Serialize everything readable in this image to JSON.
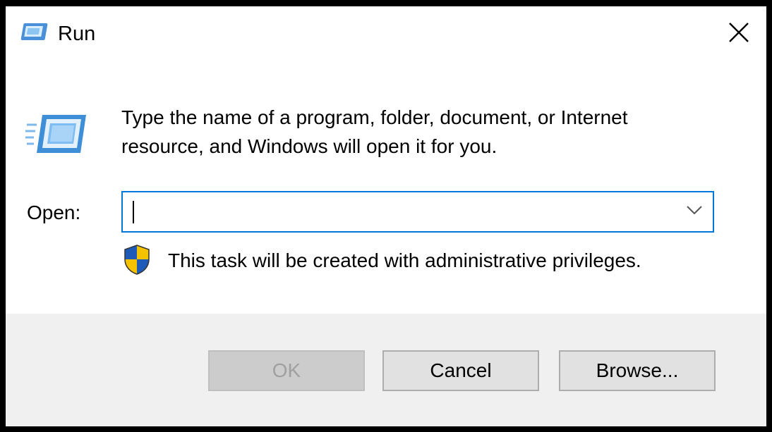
{
  "window": {
    "title": "Run",
    "title_icon": "run-icon",
    "close_icon": "close-icon"
  },
  "body": {
    "icon": "run-icon",
    "message_line1": "Type the name of a program, folder, document, or Internet",
    "message_line2": "resource, and Windows will open it for you.",
    "open_label": "Open:",
    "open_value": "",
    "dropdown_icon": "chevron-down-icon",
    "admin_icon": "uac-shield-icon",
    "admin_text": "This task will be created with administrative privileges."
  },
  "buttons": {
    "ok": {
      "label": "OK",
      "enabled": false
    },
    "cancel": {
      "label": "Cancel",
      "enabled": true
    },
    "browse": {
      "label": "Browse...",
      "enabled": true
    }
  },
  "colors": {
    "focus_border": "#0078d7",
    "footer_bg": "#f0f0f0",
    "button_bg": "#e1e1e1",
    "disabled_text": "#a0a0a0"
  }
}
